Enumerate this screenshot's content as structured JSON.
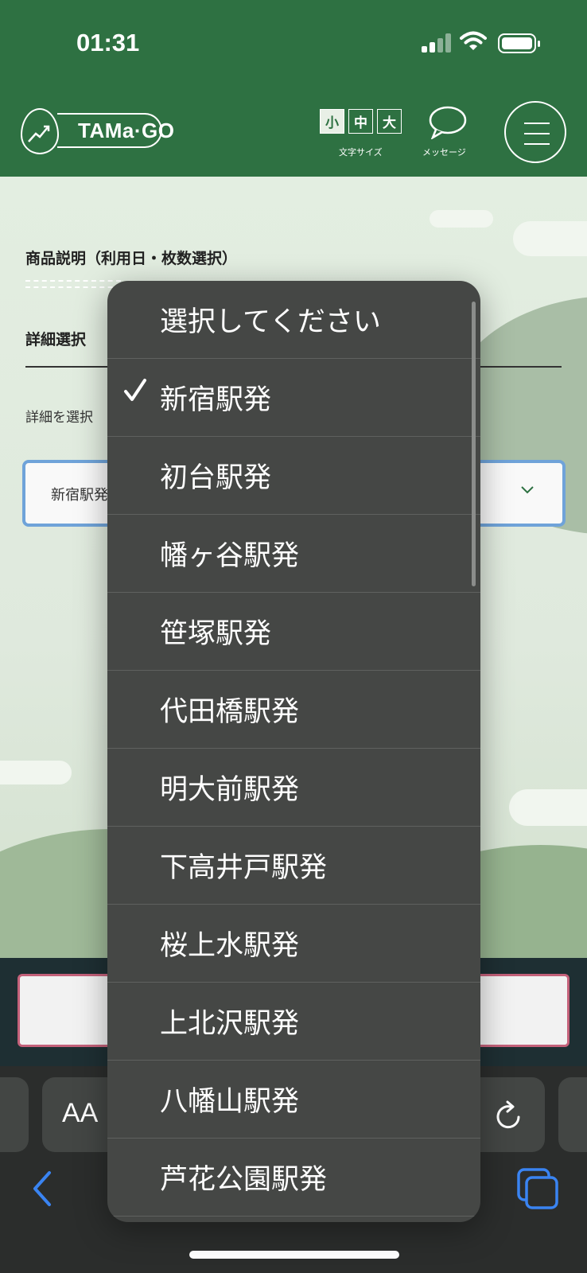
{
  "status_bar": {
    "time": "01:31"
  },
  "header": {
    "logo_text": "TAMa·GO",
    "font_size_buttons": [
      "小",
      "中",
      "大"
    ],
    "font_size_selected": "小",
    "font_size_label": "文字サイズ",
    "message_label": "メッセージ",
    "icons": [
      "message-icon",
      "hamburger-menu-icon"
    ]
  },
  "content": {
    "product_description_heading": "商品説明（利用日・枚数選択）",
    "detail_heading": "詳細選択",
    "detail_hint": "詳細を選択",
    "select_value": "新宿駅発"
  },
  "dropdown": {
    "selected": "新宿駅発",
    "options": [
      "選択してください",
      "新宿駅発",
      "初台駅発",
      "幡ヶ谷駅発",
      "笹塚駅発",
      "代田橋駅発",
      "明大前駅発",
      "下高井戸駅発",
      "桜上水駅発",
      "上北沢駅発",
      "八幡山駅発",
      "芦花公園駅発"
    ]
  },
  "browser": {
    "text_size_label": "AA",
    "icons": [
      "reload-icon",
      "back-arrow-icon",
      "tabs-icon"
    ],
    "accent_color": "#3a84f2"
  },
  "colors": {
    "header_bg": "#2e7142",
    "dropdown_bg": "#454745",
    "select_border": "#6fa3d9",
    "button_border": "#c4617a"
  }
}
